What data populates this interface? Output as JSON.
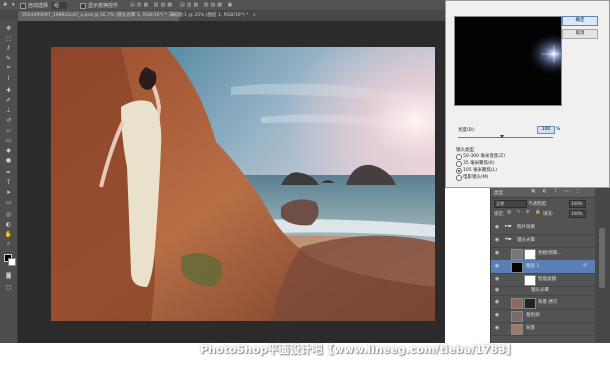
{
  "options_bar": {
    "tool_menu": "▾",
    "auto_select_label": "自动选择",
    "auto_select_target": "组",
    "transform_label": "显示变换控件"
  },
  "tabs": [
    {
      "label": "9564499097_1989a5cd7_o.psd @ 16.7% (镜头光晕 1, RGB/16*) *",
      "active": true
    },
    {
      "label": "未标题-1 @ 25% (图层 1, RGB/16*) *",
      "active": false
    }
  ],
  "dialog": {
    "ok_label": "确定",
    "cancel_label": "取消",
    "brightness_label": "亮度(B):",
    "brightness_value": "100",
    "brightness_unit": "%",
    "lens_type_label": "镜头类型",
    "lens_options": [
      {
        "label": "50-300 毫米变焦(Z)",
        "selected": false
      },
      {
        "label": "35 毫米聚焦(K)",
        "selected": false
      },
      {
        "label": "105 毫米聚焦(L)",
        "selected": true
      },
      {
        "label": "电影镜头(M)",
        "selected": false
      }
    ]
  },
  "layers_panel": {
    "kind_label": "类型",
    "blend_mode": "正常",
    "opacity_label": "不透明度:",
    "opacity_value": "100%",
    "lock_label": "锁定:",
    "fill_label": "填充:",
    "fill_value": "100%",
    "layers": [
      {
        "name": "照片效果",
        "type": "group",
        "indent": 0,
        "selected": false
      },
      {
        "name": "镜头光晕",
        "type": "group",
        "indent": 0,
        "selected": false
      },
      {
        "name": "色相/饱和...",
        "type": "adjust",
        "indent": 1,
        "selected": false
      },
      {
        "name": "图层 1",
        "type": "layer",
        "indent": 1,
        "selected": true
      },
      {
        "name": "智能滤镜",
        "type": "filter",
        "indent": 2,
        "selected": false
      },
      {
        "name": "镜头光晕",
        "type": "filter",
        "indent": 2,
        "selected": false
      },
      {
        "name": "背景 拷贝",
        "type": "layer",
        "indent": 0,
        "selected": false
      },
      {
        "name": "基色调",
        "type": "layer",
        "indent": 0,
        "selected": false
      },
      {
        "name": "背景",
        "type": "layer",
        "indent": 0,
        "selected": false
      }
    ]
  },
  "watermark": "PhotoShop平面设计吧【www.lineeg.com/tieba/1783】",
  "colors": {
    "accent": "#5a7fb5",
    "panel": "#535353",
    "dark": "#2b2b2b"
  }
}
